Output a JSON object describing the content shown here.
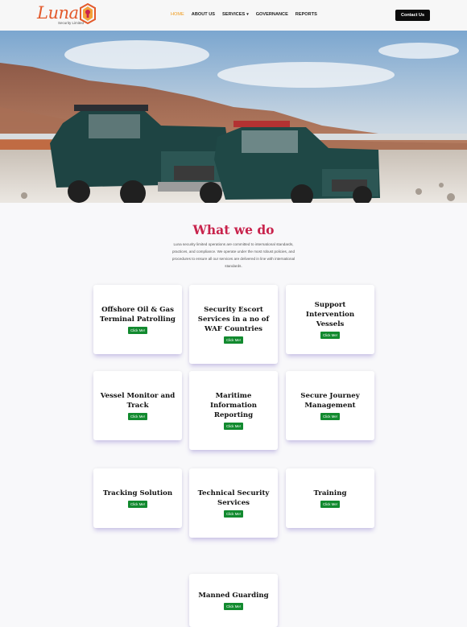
{
  "header": {
    "logo_text": "Luna",
    "logo_sub": "Security Limited",
    "nav": [
      {
        "label": "HOME",
        "active": true
      },
      {
        "label": "ABOUT US"
      },
      {
        "label": "SERVICES",
        "caret": "▾"
      },
      {
        "label": "GOVERNANCE"
      },
      {
        "label": "REPORTS"
      }
    ],
    "contact_label": "Contact Us"
  },
  "colors": {
    "accent": "#f09a1a",
    "title": "#c8234c",
    "button_green": "#128a2f",
    "logo": "#e35a2c"
  },
  "hero": {
    "icon": "desert-landcruisers-photo"
  },
  "section": {
    "title": "What we do",
    "description": "Luna security limited operations are committed to international standards, practices, and compliance. We operate under the most robust policies, and procedures to ensure all our services are delivered in line with international standards."
  },
  "services": [
    {
      "title": "Offshore Oil & Gas Terminal Patrolling",
      "button": "Click Me!"
    },
    {
      "title": "Security Escort Services in a no of WAF Countries",
      "button": "Click Me!"
    },
    {
      "title": "Support Intervention Vessels",
      "button": "Click Me!"
    },
    {
      "title": "Vessel Monitor and Track",
      "button": "Click Me!"
    },
    {
      "title": "Maritime Information Reporting",
      "button": "Click Me!"
    },
    {
      "title": "Secure Journey Management",
      "button": "Click Me!"
    },
    {
      "title": "Tracking Solution",
      "button": "Click Me!"
    },
    {
      "title": "Technical Security Services",
      "button": "Click Me!"
    },
    {
      "title": "Training",
      "button": "Click Me!"
    },
    {
      "title": "Manned Guarding",
      "button": "Click Me!"
    }
  ]
}
